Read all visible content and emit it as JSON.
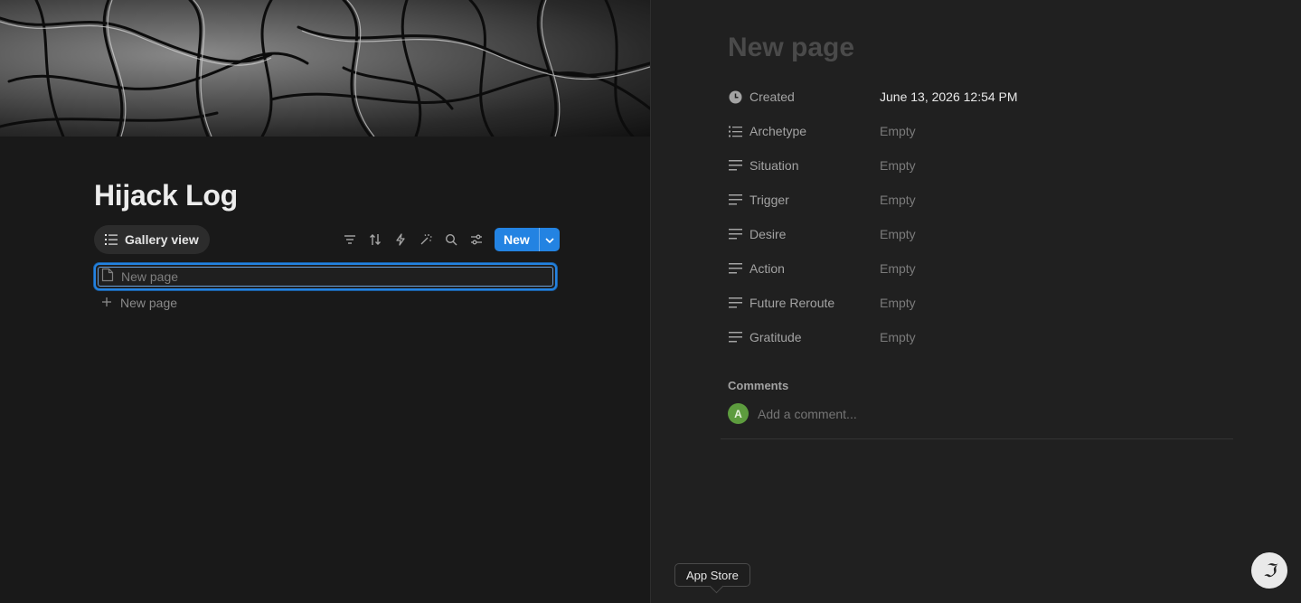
{
  "database": {
    "title": "Hijack Log",
    "view_tab_label": "Gallery view",
    "new_button_label": "New",
    "selected_row_placeholder": "New page",
    "add_row_label": "New page"
  },
  "page": {
    "title_placeholder": "New page",
    "properties": [
      {
        "name": "Created",
        "value": "June 13, 2026 12:54 PM",
        "icon": "clock-icon"
      },
      {
        "name": "Archetype",
        "value": "Empty",
        "icon": "list-icon"
      },
      {
        "name": "Situation",
        "value": "Empty",
        "icon": "text-icon"
      },
      {
        "name": "Trigger",
        "value": "Empty",
        "icon": "text-icon"
      },
      {
        "name": "Desire",
        "value": "Empty",
        "icon": "text-icon"
      },
      {
        "name": "Action",
        "value": "Empty",
        "icon": "text-icon"
      },
      {
        "name": "Future Reroute",
        "value": "Empty",
        "icon": "text-icon"
      },
      {
        "name": "Gratitude",
        "value": "Empty",
        "icon": "text-icon"
      }
    ],
    "comments_heading": "Comments",
    "avatar_initial": "A",
    "comment_placeholder": "Add a comment..."
  },
  "tooltip": {
    "label": "App Store"
  },
  "colors": {
    "accent": "#2383e2",
    "avatar": "#5d9c3e",
    "background": "#191919",
    "panel": "#202020"
  }
}
